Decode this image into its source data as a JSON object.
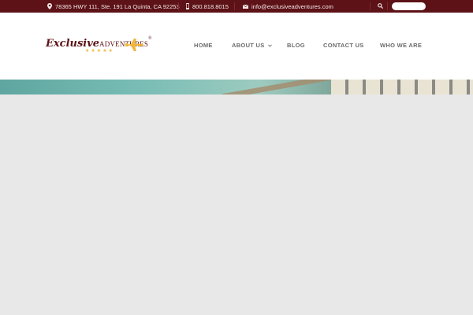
{
  "topbar": {
    "address": "78365 HWY 111, Ste. 191 La Quinta, CA 92253",
    "phone": "800.818.8015",
    "email": "info@exclusiveadventures.com",
    "address_icon": "map-marker-icon",
    "phone_icon": "mobile-phone-icon",
    "email_icon": "envelope-icon",
    "search_icon": "search-icon",
    "background_color": "#5c1216"
  },
  "logo": {
    "script_text": "Exclusive",
    "caps_text": "ADVENTURES",
    "trademark": "®",
    "icon": "airplane-icon",
    "brand_color": "#5c1216",
    "accent_color": "#f2b739"
  },
  "nav": {
    "items": [
      {
        "label": "HOME"
      },
      {
        "label": "ABOUT US",
        "dropdown": true
      },
      {
        "label": "BLOG"
      },
      {
        "label": "CONTACT US"
      },
      {
        "label": "WHO WE ARE"
      }
    ],
    "dropdown_icon": "chevron-down-icon"
  }
}
